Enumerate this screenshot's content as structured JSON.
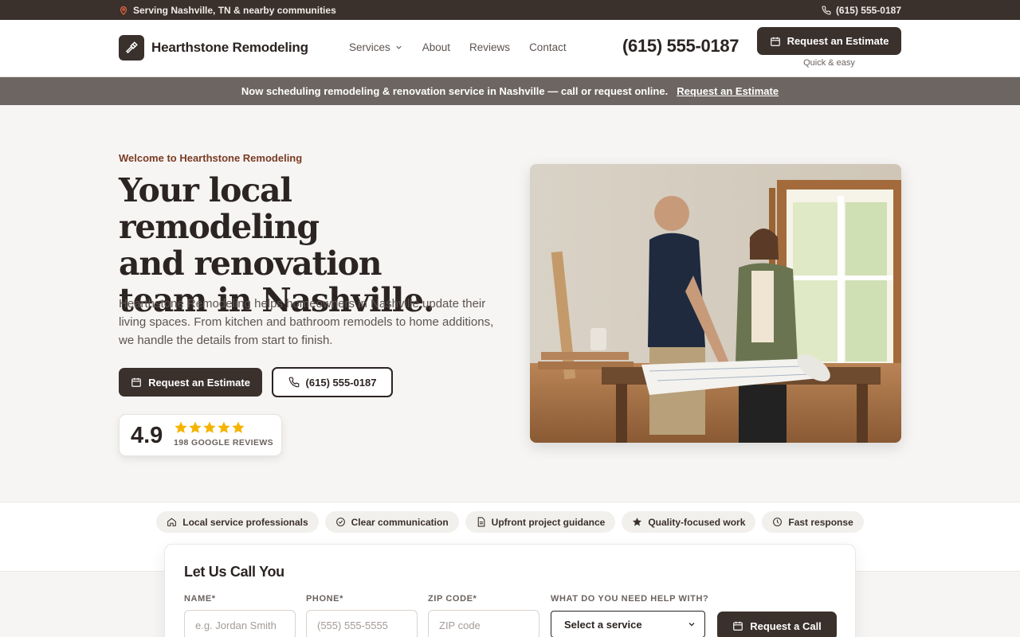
{
  "topbar": {
    "service_area": "Serving Nashville, TN & nearby communities",
    "phone": "(615) 555-0187"
  },
  "header": {
    "brand": "Hearthstone Remodeling",
    "nav": [
      {
        "label": "Services",
        "has_dropdown": true
      },
      {
        "label": "About"
      },
      {
        "label": "Reviews"
      },
      {
        "label": "Contact"
      }
    ],
    "phone": "(615) 555-0187",
    "cta_label": "Request an Estimate",
    "cta_note": "Quick & easy"
  },
  "announcement": {
    "text": "Now scheduling remodeling & renovation service in Nashville — call or request online.",
    "link": "Request an Estimate"
  },
  "hero": {
    "eyebrow": "Welcome to Hearthstone Remodeling",
    "headline_lines": [
      "Your local remodeling",
      "and renovation",
      "team in Nashville."
    ],
    "intro": "Hearthstone Remodeling helps homeowners in Nashville update their living spaces. From kitchen and bathroom remodels to home additions, we handle the details from start to finish.",
    "primary_cta": "Request an Estimate",
    "phone_cta": "(615) 555-0187",
    "rating": {
      "score": "4.9",
      "stars": 5,
      "reviews": "198 GOOGLE REVIEWS"
    }
  },
  "trust_chips": [
    {
      "label": "Local service professionals",
      "icon": "home-icon"
    },
    {
      "label": "Clear communication",
      "icon": "check-circle-icon"
    },
    {
      "label": "Upfront project guidance",
      "icon": "document-icon"
    },
    {
      "label": "Quality-focused work",
      "icon": "star-icon"
    },
    {
      "label": "Fast response",
      "icon": "clock-icon"
    }
  ],
  "callback_form": {
    "title": "Let Us Call You",
    "name_label": "NAME*",
    "name_placeholder": "e.g. Jordan Smith",
    "phone_label": "PHONE*",
    "phone_placeholder": "(555) 555-5555",
    "zip_label": "ZIP CODE*",
    "zip_placeholder": "ZIP code",
    "service_label": "WHAT DO YOU NEED HELP WITH?",
    "service_selected": "Select a service",
    "submit_label": "Request a Call"
  },
  "colors": {
    "brand_dark": "#3a302c",
    "accent_brown": "#7a3b24",
    "star_gold": "#f5b400",
    "banner_gray": "#6d6561"
  }
}
